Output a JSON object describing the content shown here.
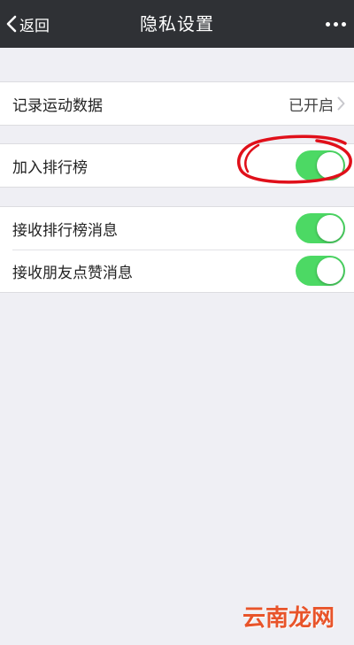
{
  "navbar": {
    "back_label": "返回",
    "title": "隐私设置",
    "more_icon": "more-dots-icon"
  },
  "settings": {
    "record_data": {
      "label": "记录运动数据",
      "value": "已开启"
    },
    "join_ranking": {
      "label": "加入排行榜",
      "enabled": true
    },
    "receive_ranking_msg": {
      "label": "接收排行榜消息",
      "enabled": true
    },
    "receive_like_msg": {
      "label": "接收朋友点赞消息",
      "enabled": true
    }
  },
  "watermark": "云南龙网",
  "colors": {
    "navbar_bg": "#2f3135",
    "toggle_on": "#4cd964",
    "annotation": "#e0101a",
    "watermark": "#e8542a"
  }
}
